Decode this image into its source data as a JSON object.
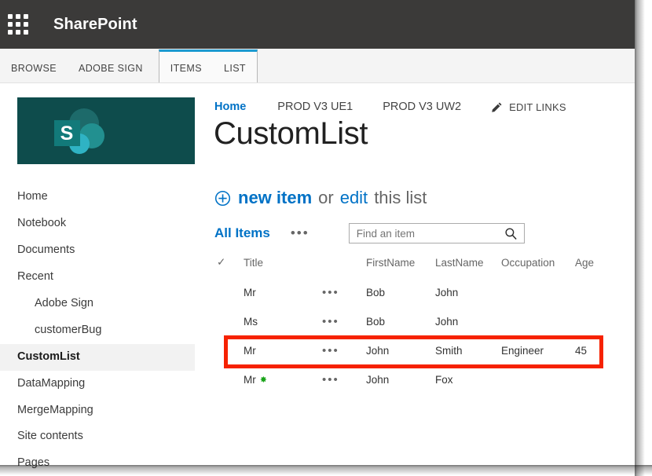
{
  "suitebar": {
    "waffle_icon": "app-launcher-waffle-icon",
    "title": "SharePoint"
  },
  "ribbon": {
    "tabs": [
      {
        "label": "BROWSE",
        "active": false,
        "grouped": false
      },
      {
        "label": "ADOBE SIGN",
        "active": false,
        "grouped": false
      },
      {
        "label": "ITEMS",
        "active": true,
        "grouped": true
      },
      {
        "label": "LIST",
        "active": false,
        "grouped": true
      }
    ],
    "active_group_accent": "#1d9bd1"
  },
  "site_logo": {
    "alt": "sharepoint-site-logo",
    "background": "#0e4c4c",
    "letter": "S"
  },
  "quicklaunch": {
    "items": [
      {
        "label": "Home",
        "child": false,
        "selected": false
      },
      {
        "label": "Notebook",
        "child": false,
        "selected": false
      },
      {
        "label": "Documents",
        "child": false,
        "selected": false
      },
      {
        "label": "Recent",
        "child": false,
        "selected": false
      },
      {
        "label": "Adobe Sign",
        "child": true,
        "selected": false
      },
      {
        "label": "customerBug",
        "child": true,
        "selected": false
      },
      {
        "label": "CustomList",
        "child": false,
        "selected": true
      },
      {
        "label": "DataMapping",
        "child": false,
        "selected": false
      },
      {
        "label": "MergeMapping",
        "child": false,
        "selected": false
      },
      {
        "label": "Site contents",
        "child": false,
        "selected": false
      },
      {
        "label": "Pages",
        "child": false,
        "selected": false
      }
    ]
  },
  "toplinks": {
    "items": [
      {
        "label": "Home",
        "active": true
      },
      {
        "label": "PROD V3 UE1",
        "active": false
      },
      {
        "label": "PROD V3 UW2",
        "active": false
      }
    ],
    "edit_links": {
      "icon": "pencil-icon",
      "label": "EDIT LINKS"
    }
  },
  "page": {
    "title": "CustomList"
  },
  "commands": {
    "plus_icon": "circle-plus-icon",
    "new_item": "new item",
    "or": "or",
    "edit": "edit",
    "tail": "this list"
  },
  "viewbar": {
    "view_name": "All Items",
    "ellipsis": "•••",
    "search": {
      "placeholder": "Find an item",
      "value": "",
      "icon": "search-icon"
    }
  },
  "list": {
    "columns": [
      {
        "key": "check",
        "label": "✓"
      },
      {
        "key": "title",
        "label": "Title"
      },
      {
        "key": "dots",
        "label": ""
      },
      {
        "key": "firstname",
        "label": "FirstName"
      },
      {
        "key": "lastname",
        "label": "LastName"
      },
      {
        "key": "occupation",
        "label": "Occupation"
      },
      {
        "key": "age",
        "label": "Age"
      }
    ],
    "rows": [
      {
        "title": "Mr",
        "dots": "•••",
        "firstname": "Bob",
        "lastname": "John",
        "occupation": "",
        "age": "",
        "is_new": false,
        "highlighted": false
      },
      {
        "title": "Ms",
        "dots": "•••",
        "firstname": "Bob",
        "lastname": "John",
        "occupation": "",
        "age": "",
        "is_new": false,
        "highlighted": false
      },
      {
        "title": "Mr",
        "dots": "•••",
        "firstname": "John",
        "lastname": "Smith",
        "occupation": "Engineer",
        "age": "45",
        "is_new": false,
        "highlighted": true
      },
      {
        "title": "Mr",
        "dots": "•••",
        "firstname": "John",
        "lastname": "Fox",
        "occupation": "",
        "age": "",
        "is_new": true,
        "highlighted": false
      }
    ],
    "new_badge_glyph": "✸",
    "new_badge_color": "#19a319"
  },
  "annotation": {
    "highlight_color": "#f62200",
    "target_row_index": 2
  },
  "colors": {
    "suitebar_bg": "#3b3a39",
    "accent_blue": "#0072c6",
    "ribbon_bg": "#f4f4f4",
    "selected_nav_bg": "#f2f2f2"
  }
}
